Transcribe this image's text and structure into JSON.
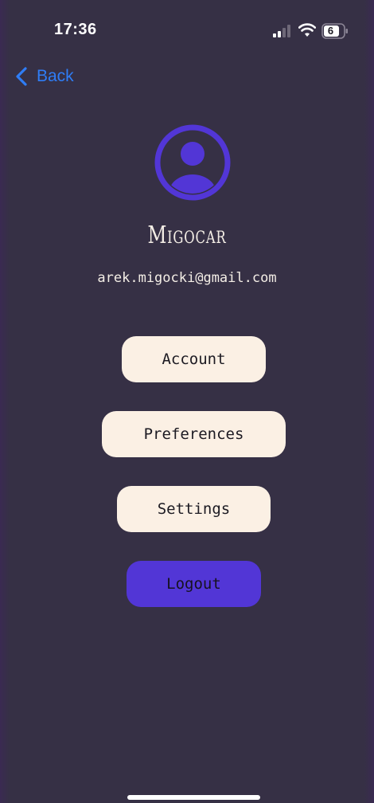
{
  "status_bar": {
    "time": "17:36",
    "battery_level": "6",
    "icons": [
      "signal-icon",
      "wifi-icon",
      "battery-icon"
    ]
  },
  "nav": {
    "back_label": "Back",
    "back_icon": "chevron-left-icon"
  },
  "profile": {
    "avatar_icon": "user-circle-icon",
    "name": "Migocar",
    "email": "arek.migocki@gmail.com"
  },
  "menu": {
    "account_label": "Account",
    "preferences_label": "Preferences",
    "settings_label": "Settings",
    "logout_label": "Logout"
  },
  "colors": {
    "background": "#363045",
    "link_blue": "#2f7df6",
    "accent_purple": "#5236d6",
    "button_cream": "#fbf0e4",
    "text_light": "#f4eee6"
  }
}
